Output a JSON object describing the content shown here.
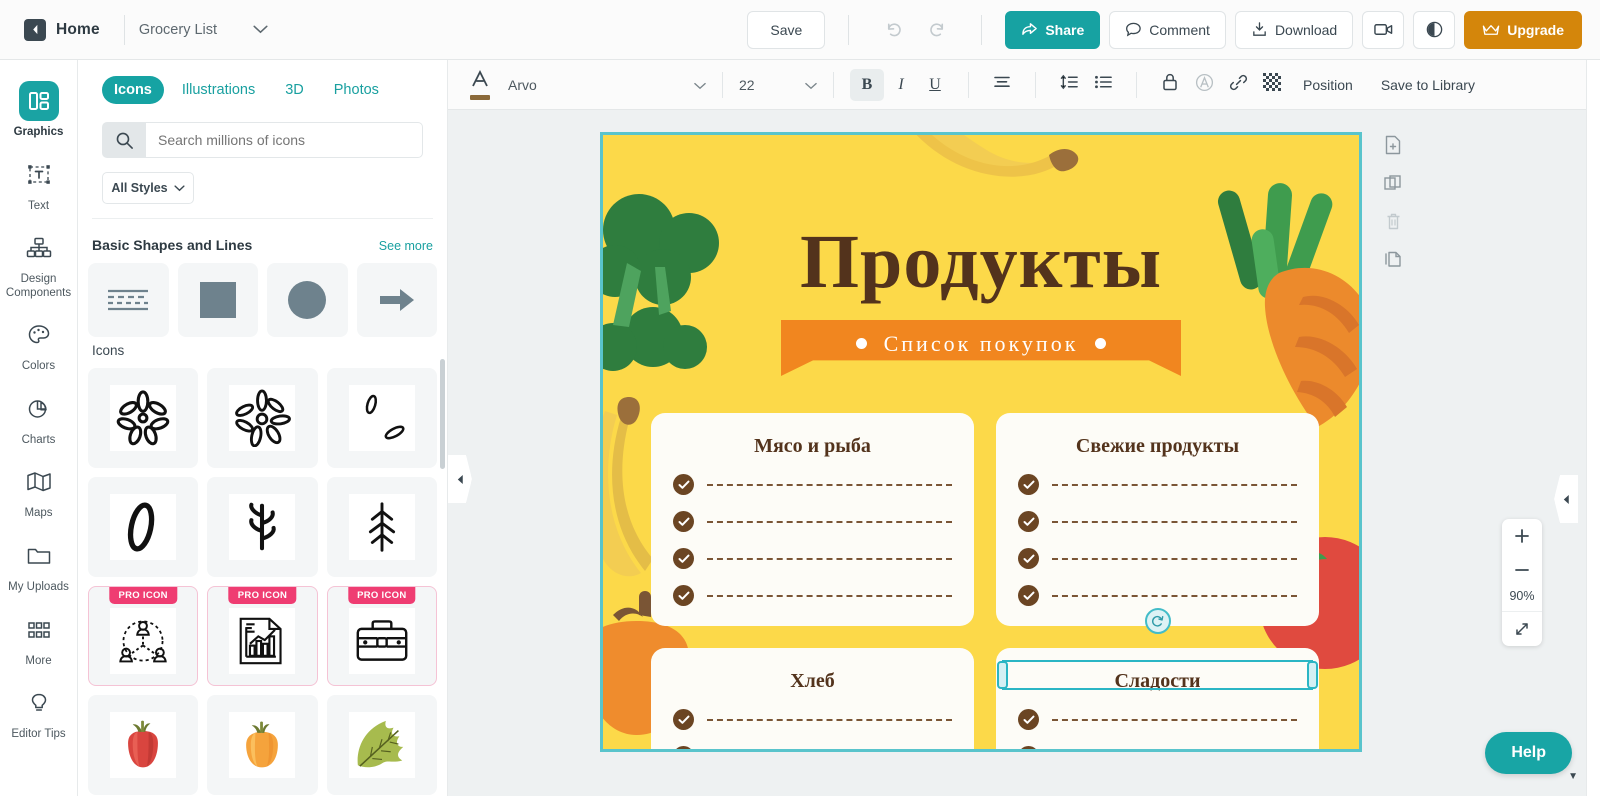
{
  "topbar": {
    "home_label": "Home",
    "doc_title": "Grocery List",
    "save_label": "Save",
    "share_label": "Share",
    "comment_label": "Comment",
    "download_label": "Download",
    "upgrade_label": "Upgrade",
    "accent_teal": "#17a2a2",
    "accent_orange": "#d4860b"
  },
  "rail": {
    "items": [
      {
        "label": "Graphics",
        "icon": "graphics-icon",
        "active": true
      },
      {
        "label": "Text",
        "icon": "text-icon",
        "active": false
      },
      {
        "label": "Design Components",
        "icon": "design-components-icon",
        "active": false
      },
      {
        "label": "Colors",
        "icon": "palette-icon",
        "active": false
      },
      {
        "label": "Charts",
        "icon": "pie-chart-icon",
        "active": false
      },
      {
        "label": "Maps",
        "icon": "map-icon",
        "active": false
      },
      {
        "label": "My Uploads",
        "icon": "folder-icon",
        "active": false
      },
      {
        "label": "More",
        "icon": "grid-dots-icon",
        "active": false
      },
      {
        "label": "Editor Tips",
        "icon": "lightbulb-icon",
        "active": false
      }
    ]
  },
  "panel": {
    "tabs": [
      {
        "label": "Icons",
        "active": true
      },
      {
        "label": "Illustrations",
        "active": false
      },
      {
        "label": "3D",
        "active": false
      },
      {
        "label": "Photos",
        "active": false
      }
    ],
    "search_placeholder": "Search millions of icons",
    "search_value": "",
    "styles_label": "All Styles",
    "section_shapes_title": "Basic Shapes and Lines",
    "see_more_label": "See more",
    "section_icons_title": "Icons",
    "shapes": [
      "dashed-lines-shape",
      "square-shape",
      "circle-shape",
      "arrow-right-shape"
    ],
    "icons": [
      {
        "name": "daisy-flower-icon",
        "pro": false
      },
      {
        "name": "daisy-flower-alt-icon",
        "pro": false
      },
      {
        "name": "seeds-icon",
        "pro": false
      },
      {
        "name": "leaf-outline-icon",
        "pro": false
      },
      {
        "name": "sprout-icon",
        "pro": false
      },
      {
        "name": "fir-tree-icon",
        "pro": false
      },
      {
        "name": "team-network-icon",
        "pro": true
      },
      {
        "name": "report-chart-icon",
        "pro": true
      },
      {
        "name": "briefcase-icon",
        "pro": true
      },
      {
        "name": "red-pepper-icon",
        "pro": false
      },
      {
        "name": "pumpkin-icon",
        "pro": false
      },
      {
        "name": "green-leaf-icon",
        "pro": false
      }
    ],
    "pro_badge_label": "PRO ICON"
  },
  "format_bar": {
    "font_name": "Arvo",
    "font_size": "22",
    "bold_label": "B",
    "italic_label": "I",
    "underline_label": "U",
    "position_label": "Position",
    "save_library_label": "Save to Library",
    "bold_active": true
  },
  "canvas": {
    "design_title": "Продукты",
    "ribbon_text": "Список покупок",
    "background_color": "#fcd949",
    "ribbon_color": "#f1861f",
    "title_color": "#53331c",
    "selection_color": "#2bb5c4",
    "cards": [
      {
        "title": "Мясо и рыба",
        "rows": 4,
        "selected": false
      },
      {
        "title": "Свежие продукты",
        "rows": 4,
        "selected": false
      },
      {
        "title": "Хлеб",
        "rows": 2,
        "selected": false
      },
      {
        "title": "Сладости",
        "rows": 2,
        "selected": true
      }
    ],
    "page_tools": [
      "add-page-icon",
      "duplicate-page-icon",
      "delete-page-icon",
      "copy-page-icon"
    ]
  },
  "zoom_widget": {
    "zoom_in_label": "+",
    "zoom_out_label": "–",
    "zoom_level": "90%",
    "fit_icon": "fit-screen-icon"
  },
  "help": {
    "label": "Help"
  }
}
